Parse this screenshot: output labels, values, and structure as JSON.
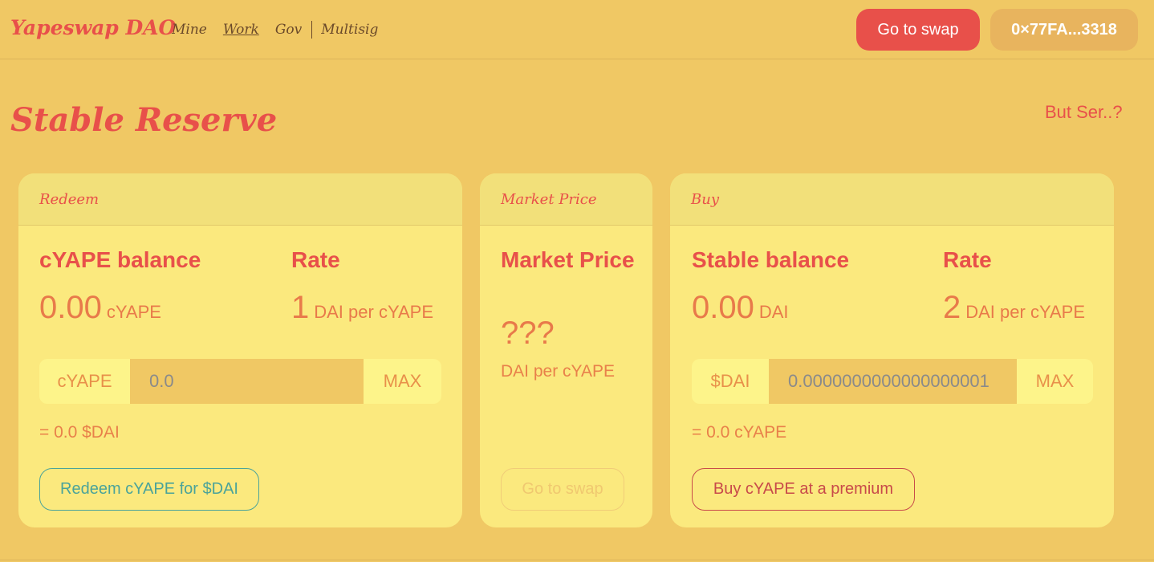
{
  "nav": {
    "brand": "Yapeswap DAO",
    "links": [
      "Mine",
      "Work",
      "Gov",
      "Multisig"
    ],
    "go_to_swap": "Go to swap",
    "wallet": "0×77FA...3318"
  },
  "page": {
    "title": "Stable Reserve",
    "help_link": "But Ser..?"
  },
  "redeem": {
    "header": "Redeem",
    "balance_label": "cYAPE balance",
    "balance_value": "0.00",
    "balance_unit": "cYAPE",
    "rate_label": "Rate",
    "rate_value": "1",
    "rate_unit": "DAI per cYAPE",
    "input_prefix": "cYAPE",
    "input_value": "0.0",
    "max_label": "MAX",
    "equiv": "= 0.0 $DAI",
    "action": "Redeem cYAPE for $DAI"
  },
  "market": {
    "header": "Market Price",
    "label": "Market Price",
    "value": "???",
    "unit": "DAI per cYAPE",
    "action": "Go to swap"
  },
  "buy": {
    "header": "Buy",
    "balance_label": "Stable balance",
    "balance_value": "0.00",
    "balance_unit": "DAI",
    "rate_label": "Rate",
    "rate_value": "2",
    "rate_unit": "DAI per cYAPE",
    "input_prefix": "$DAI",
    "input_value": "0.0000000000000000001",
    "max_label": "MAX",
    "equiv": "= 0.0 cYAPE",
    "action": "Buy cYAPE at a premium"
  },
  "colors": {
    "background": "#f0c864",
    "accent": "#e8504a",
    "card": "#fbe97e",
    "teal": "#4aa39a"
  }
}
